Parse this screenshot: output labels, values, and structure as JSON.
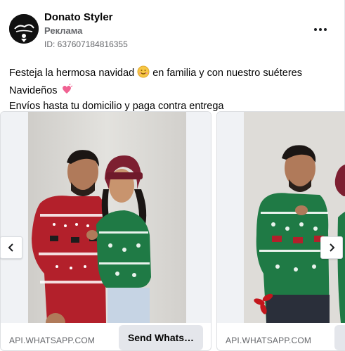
{
  "header": {
    "page_name": "Donato Styler",
    "sponsored": "Реклама",
    "ad_id": "ID: 637607184816355",
    "logo_text": "Donato's Styler"
  },
  "post": {
    "line1_a": "Festeja la hermosa navidad",
    "line1_b": "en familia y con nuestro suéteres",
    "line2": "Navideños",
    "line3": "Envíos hasta tu domicilio y paga contra entrega"
  },
  "carousel": {
    "cards": [
      {
        "domain": "API.WHATSAPP.COM",
        "cta": "Send Whats…"
      },
      {
        "domain": "API.WHATSAPP.COM",
        "cta": ""
      }
    ]
  },
  "icons": {
    "more": "more-options-icon",
    "prev": "chevron-left-icon",
    "next": "chevron-right-icon"
  },
  "colors": {
    "text_primary": "#050505",
    "text_secondary": "#65676b",
    "cta_bg": "#e4e6eb",
    "sweater_red": "#b3202b",
    "sweater_green": "#1f7a45"
  }
}
